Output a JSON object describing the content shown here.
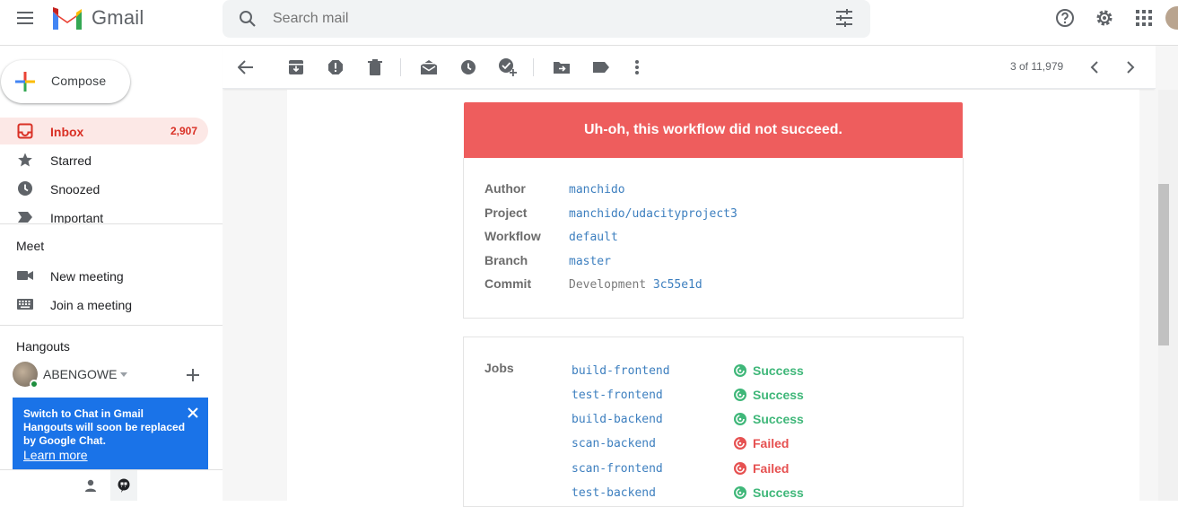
{
  "app": {
    "name": "Gmail"
  },
  "search": {
    "placeholder": "Search mail"
  },
  "sidebar": {
    "compose_label": "Compose",
    "items": [
      {
        "label": "Inbox",
        "count": "2,907",
        "icon": "inbox-icon"
      },
      {
        "label": "Starred",
        "icon": "star-icon"
      },
      {
        "label": "Snoozed",
        "icon": "clock-icon"
      },
      {
        "label": "Important",
        "icon": "label-important-icon"
      }
    ],
    "meet": {
      "title": "Meet",
      "items": [
        {
          "label": "New meeting",
          "icon": "video-camera-icon"
        },
        {
          "label": "Join a meeting",
          "icon": "keyboard-icon"
        }
      ]
    },
    "hangouts": {
      "title": "Hangouts",
      "user": "ABENGOWE",
      "card": {
        "title": "Switch to Chat in Gmail",
        "body": "Hangouts will soon be replaced by Google Chat.",
        "link": "Learn more"
      }
    }
  },
  "toolbar": {
    "pager": "3 of 11,979"
  },
  "email": {
    "banner": "Uh-oh, this workflow did not succeed.",
    "info": [
      {
        "key": "Author",
        "value": "manchido"
      },
      {
        "key": "Project",
        "value": "manchido/udacityproject3"
      },
      {
        "key": "Workflow",
        "value": "default"
      },
      {
        "key": "Branch",
        "value": "master"
      },
      {
        "key": "Commit",
        "prefix": "Development",
        "value": "3c55e1d"
      }
    ],
    "jobs_title": "Jobs",
    "jobs": [
      {
        "name": "build-frontend",
        "status": "Success"
      },
      {
        "name": "test-frontend",
        "status": "Success"
      },
      {
        "name": "build-backend",
        "status": "Success"
      },
      {
        "name": "scan-backend",
        "status": "Failed"
      },
      {
        "name": "scan-frontend",
        "status": "Failed"
      },
      {
        "name": "test-backend",
        "status": "Success"
      }
    ]
  },
  "colors": {
    "failed_banner": "#ee5d5d",
    "success": "#3fb779",
    "failed": "#e65151",
    "link": "#3d7fbf",
    "inbox_active": "#d93025"
  }
}
